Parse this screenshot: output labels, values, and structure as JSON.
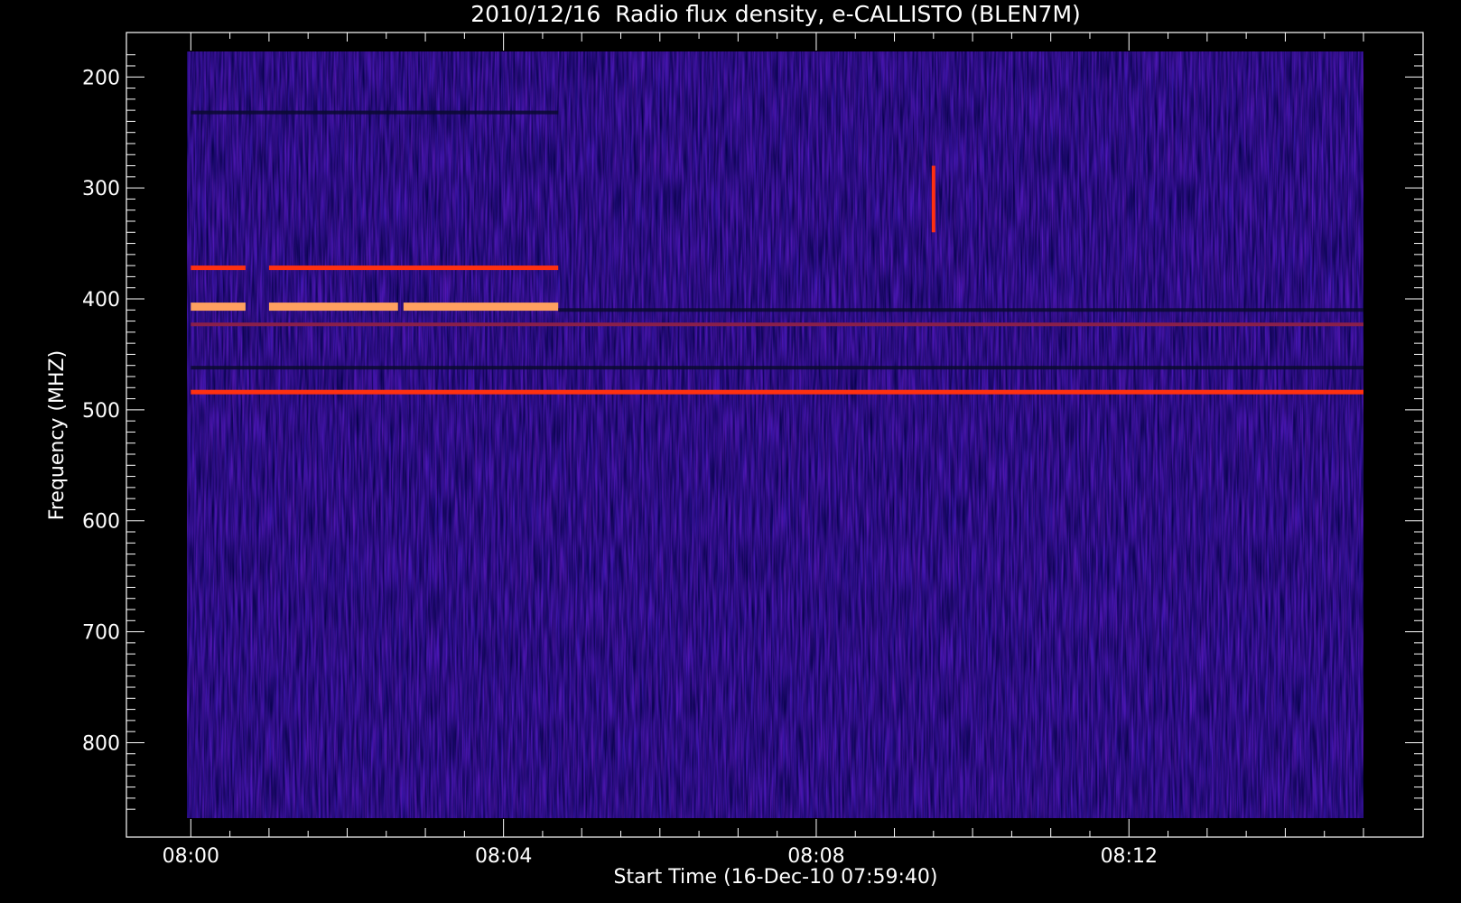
{
  "chart_data": {
    "type": "heatmap",
    "title": "2010/12/16  Radio flux density, e-CALLISTO (BLEN7M)",
    "xlabel": "Start Time (16-Dec-10 07:59:40)",
    "ylabel": "Frequency (MHZ)",
    "x_unit": "minutes after 08:00",
    "x_range": [
      -0.05,
      15.0
    ],
    "y_range": [
      177,
      868
    ],
    "x_ticks": [
      {
        "value": 0,
        "label": "08:00"
      },
      {
        "value": 4,
        "label": "08:04"
      },
      {
        "value": 8,
        "label": "08:08"
      },
      {
        "value": 12,
        "label": "08:12"
      }
    ],
    "y_ticks": [
      {
        "value": 200,
        "label": "200"
      },
      {
        "value": 300,
        "label": "300"
      },
      {
        "value": 400,
        "label": "400"
      },
      {
        "value": 500,
        "label": "500"
      },
      {
        "value": 600,
        "label": "600"
      },
      {
        "value": 700,
        "label": "700"
      },
      {
        "value": 800,
        "label": "800"
      }
    ],
    "colormap": {
      "background": "#2222e0",
      "low": "#0a0a30",
      "mid": "#8a1f4a",
      "high": "#ff3010",
      "peak": "#ffa060"
    },
    "features": [
      {
        "kind": "band",
        "freq": 372,
        "t_start": 0.0,
        "t_end": 4.7,
        "intensity": "high",
        "gaps": [
          [
            0.7,
            1.0
          ]
        ]
      },
      {
        "kind": "band",
        "freq": 407,
        "t_start": 0.0,
        "t_end": 4.7,
        "intensity": "peak",
        "gaps": [
          [
            0.7,
            1.0
          ],
          [
            2.65,
            2.72
          ]
        ]
      },
      {
        "kind": "band",
        "freq": 423,
        "t_start": 0.0,
        "t_end": 15.0,
        "intensity": "mid"
      },
      {
        "kind": "band",
        "freq": 462,
        "t_start": 0.0,
        "t_end": 15.0,
        "intensity": "low"
      },
      {
        "kind": "band",
        "freq": 484,
        "t_start": 0.0,
        "t_end": 15.0,
        "intensity": "high"
      },
      {
        "kind": "band",
        "freq": 410,
        "t_start": 4.7,
        "t_end": 15.0,
        "intensity": "low"
      },
      {
        "kind": "band",
        "freq": 232,
        "t_start": 0.0,
        "t_end": 4.7,
        "intensity": "low"
      },
      {
        "kind": "burst",
        "t": 9.5,
        "f_start": 280,
        "f_end": 340,
        "intensity": "high"
      }
    ]
  }
}
